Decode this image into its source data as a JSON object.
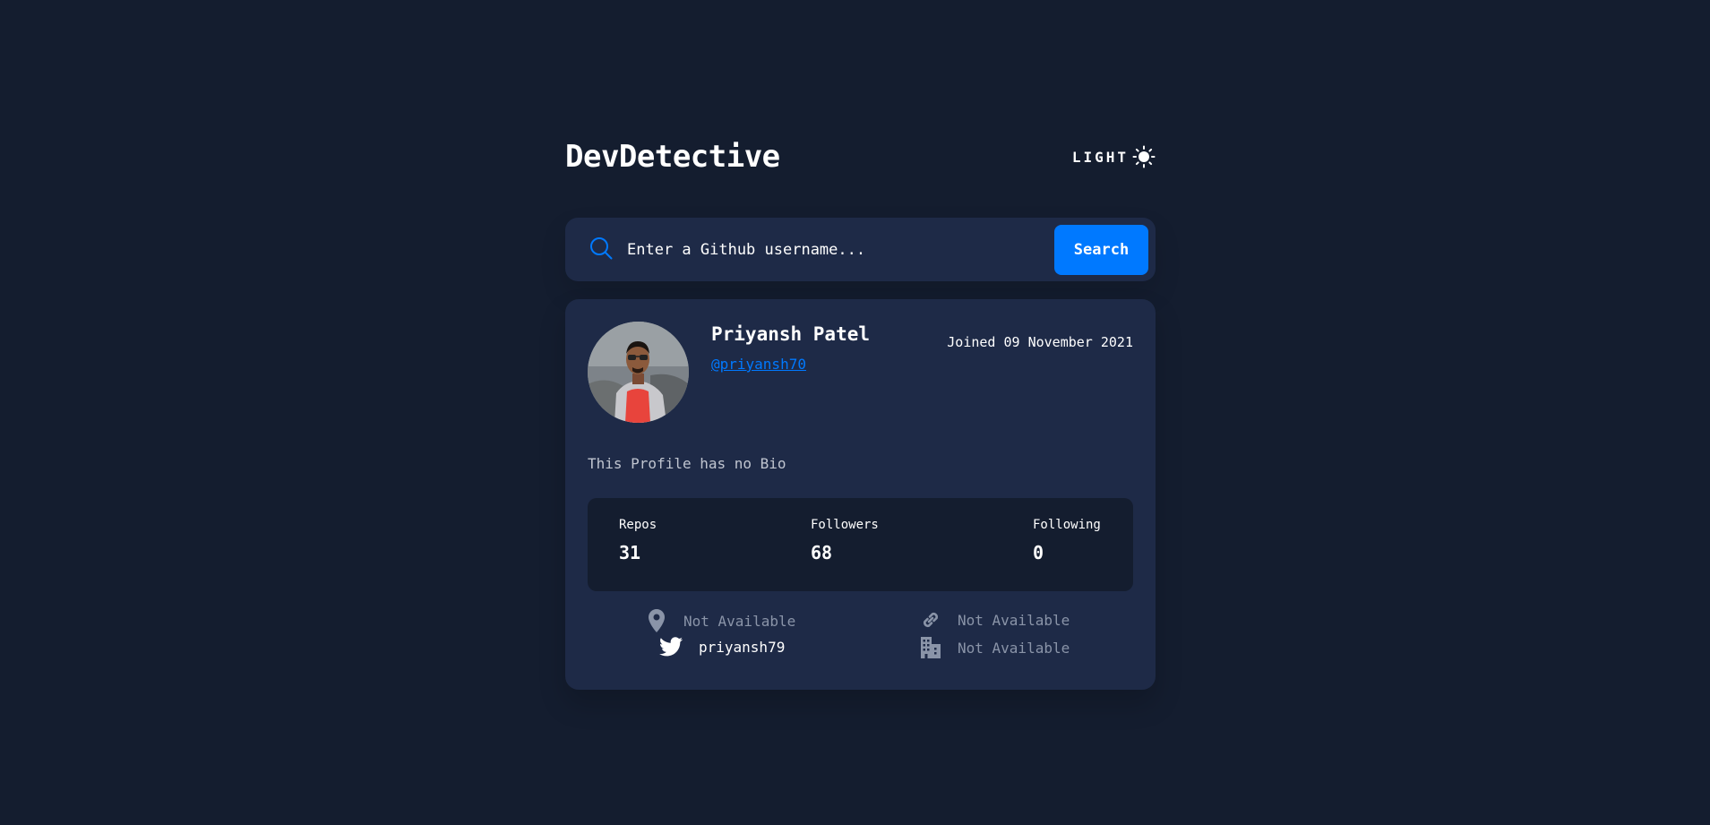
{
  "app": {
    "title": "DevDetective"
  },
  "theme_toggle": {
    "label": "LIGHT",
    "icon": "sun-icon"
  },
  "search": {
    "placeholder": "Enter a Github username...",
    "value": "",
    "button_label": "Search"
  },
  "profile": {
    "name": "Priyansh Patel",
    "username": "@priyansh70",
    "joined": "Joined 09 November 2021",
    "bio": "This Profile has no Bio",
    "avatar_icon": "user-photo"
  },
  "stats": [
    {
      "label": "Repos",
      "value": "31"
    },
    {
      "label": "Followers",
      "value": "68"
    },
    {
      "label": "Following",
      "value": "0"
    }
  ],
  "links": {
    "location": {
      "icon": "location-pin-icon",
      "text": "Not Available"
    },
    "website": {
      "icon": "link-icon",
      "text": "Not Available"
    },
    "twitter": {
      "icon": "twitter-icon",
      "text": "priyansh79"
    },
    "company": {
      "icon": "building-icon",
      "text": "Not Available"
    }
  },
  "colors": {
    "background": "#141d2f",
    "card": "#1e2a47",
    "accent": "#0079ff",
    "muted_text": "#8a94a8"
  }
}
